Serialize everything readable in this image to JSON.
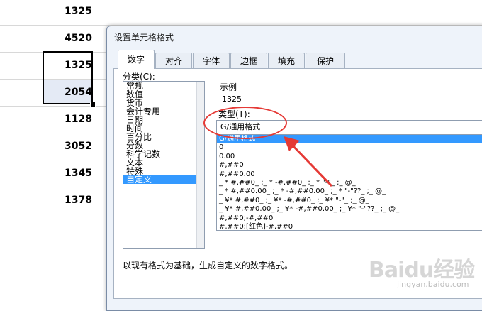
{
  "sheet": {
    "values": [
      "1325",
      "4520",
      "1325",
      "2054",
      "1128",
      "3052",
      "1345",
      "1378"
    ]
  },
  "dialog": {
    "title": "设置单元格格式",
    "tabs": [
      "数字",
      "对齐",
      "字体",
      "边框",
      "填充",
      "保护"
    ],
    "active_tab": "数字",
    "category_label": "分类(C):",
    "categories": [
      "常规",
      "数值",
      "货币",
      "会计专用",
      "日期",
      "时间",
      "百分比",
      "分数",
      "科学记数",
      "文本",
      "特殊",
      "自定义"
    ],
    "selected_category": "自定义",
    "sample_label": "示例",
    "sample_value": "1325",
    "type_label": "类型(T):",
    "type_value": "G/通用格式",
    "type_list": [
      "G/通用格式",
      "0",
      "0.00",
      "#,##0",
      "#,##0.00",
      "_ * #,##0_ ;_ * -#,##0_ ;_ * \"-\"_ ;_ @_",
      "_ * #,##0.00_ ;_ * -#,##0.00_ ;_ * \"-\"??_ ;_ @_",
      "_ ¥* #,##0_ ;_ ¥* -#,##0_ ;_ ¥* \"-\"_ ;_ @_",
      "_ ¥* #,##0.00_ ;_ ¥* -#,##0.00_ ;_ ¥* \"-\"??_ ;_ @_",
      "#,##0;-#,##0",
      "#,##0;[红色]-#,##0"
    ],
    "description": "以现有格式为基础，生成自定义的数字格式。"
  },
  "watermark": {
    "text": "Baidu经验",
    "sub": "jingyan.baidu.com"
  },
  "colors": {
    "selection": "#3399ff",
    "annotation": "#e53935"
  }
}
